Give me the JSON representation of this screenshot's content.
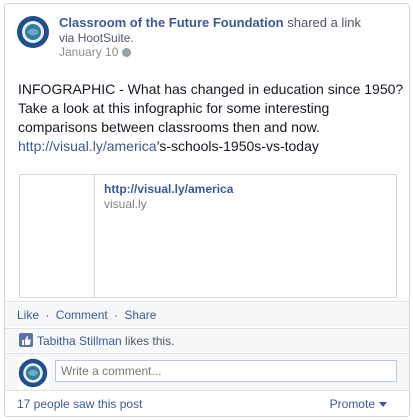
{
  "post": {
    "author": "Classroom of the Future Foundation",
    "action": "shared a link",
    "via_prefix": "via ",
    "via_app": "HootSuite",
    "via_suffix": ".",
    "timestamp": "January 10",
    "text_lines": [
      "INFOGRAPHIC - What has changed in education since 1950?",
      "Take a look at this infographic for some interesting",
      "comparisons between classrooms then and now."
    ],
    "link_part1": "http://visual.ly/america",
    "link_part2": "’s-schools-1950s-vs-today"
  },
  "attachment": {
    "title": "http://visual.ly/america",
    "domain": "visual.ly"
  },
  "actions": {
    "like": "Like",
    "comment": "Comment",
    "share": "Share",
    "separator": "·"
  },
  "likes": {
    "name": "Tabitha Stillman",
    "suffix": " likes this."
  },
  "comment_box": {
    "placeholder": "Write a comment..."
  },
  "footer": {
    "seen": "17 people saw this post",
    "promote": "Promote"
  },
  "colors": {
    "link": "#3b5998",
    "avatar_ring": "#1f4f8f",
    "avatar_center": "#2f7f9b"
  },
  "icons": {
    "globe": "globe-icon",
    "like": "thumbs-up-icon",
    "dropdown": "caret-down-icon"
  }
}
